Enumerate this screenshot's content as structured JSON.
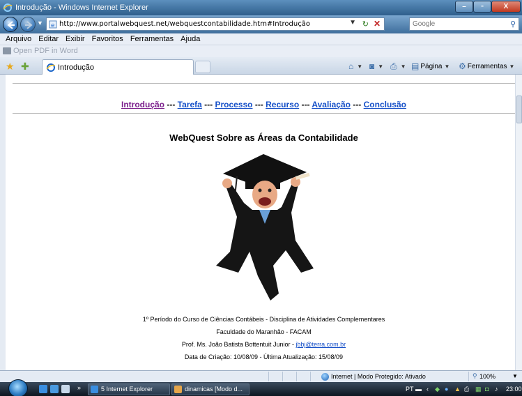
{
  "window": {
    "title": "Introdução - Windows Internet Explorer",
    "buttons": {
      "minimize": "–",
      "maximize": "▫",
      "close": "X"
    }
  },
  "address": {
    "url": "http://www.portalwebquest.net/webquestcontabilidade.htm#Introdução",
    "search_placeholder": "Google"
  },
  "menubar": [
    "Arquivo",
    "Editar",
    "Exibir",
    "Favoritos",
    "Ferramentas",
    "Ajuda"
  ],
  "pdf_toolbar": {
    "label": "Open PDF in Word"
  },
  "tab": {
    "label": "Introdução"
  },
  "command_bar": {
    "page": "Página",
    "tools": "Ferramentas"
  },
  "page": {
    "nav": {
      "links": [
        "Introdução",
        "Tarefa",
        "Processo",
        "Recurso",
        "Avaliação",
        "Conclusão"
      ],
      "separator": " --- "
    },
    "title": "WebQuest Sobre as Áreas da Contabilidade",
    "info": {
      "line1": "1º Período do Curso de Ciências Contábeis - Disciplina de Atividades Complementares",
      "line2": "Faculdade do Maranhão - FACAM",
      "line3_prefix": "Prof. Ms. João Batista Bottentuit Junior - ",
      "email": "jbbj@terra.com.br",
      "line4": "Data de Criação: 10/08/09 - Última Atualização: 15/08/09"
    }
  },
  "statusbar": {
    "status": "Internet | Modo Protegido: Ativado",
    "zoom": "100%"
  },
  "taskbar": {
    "items": [
      "5 Internet Explorer",
      "dinamicas [Modo d..."
    ],
    "tray": {
      "lang": "PT",
      "clock": "23:00"
    }
  }
}
